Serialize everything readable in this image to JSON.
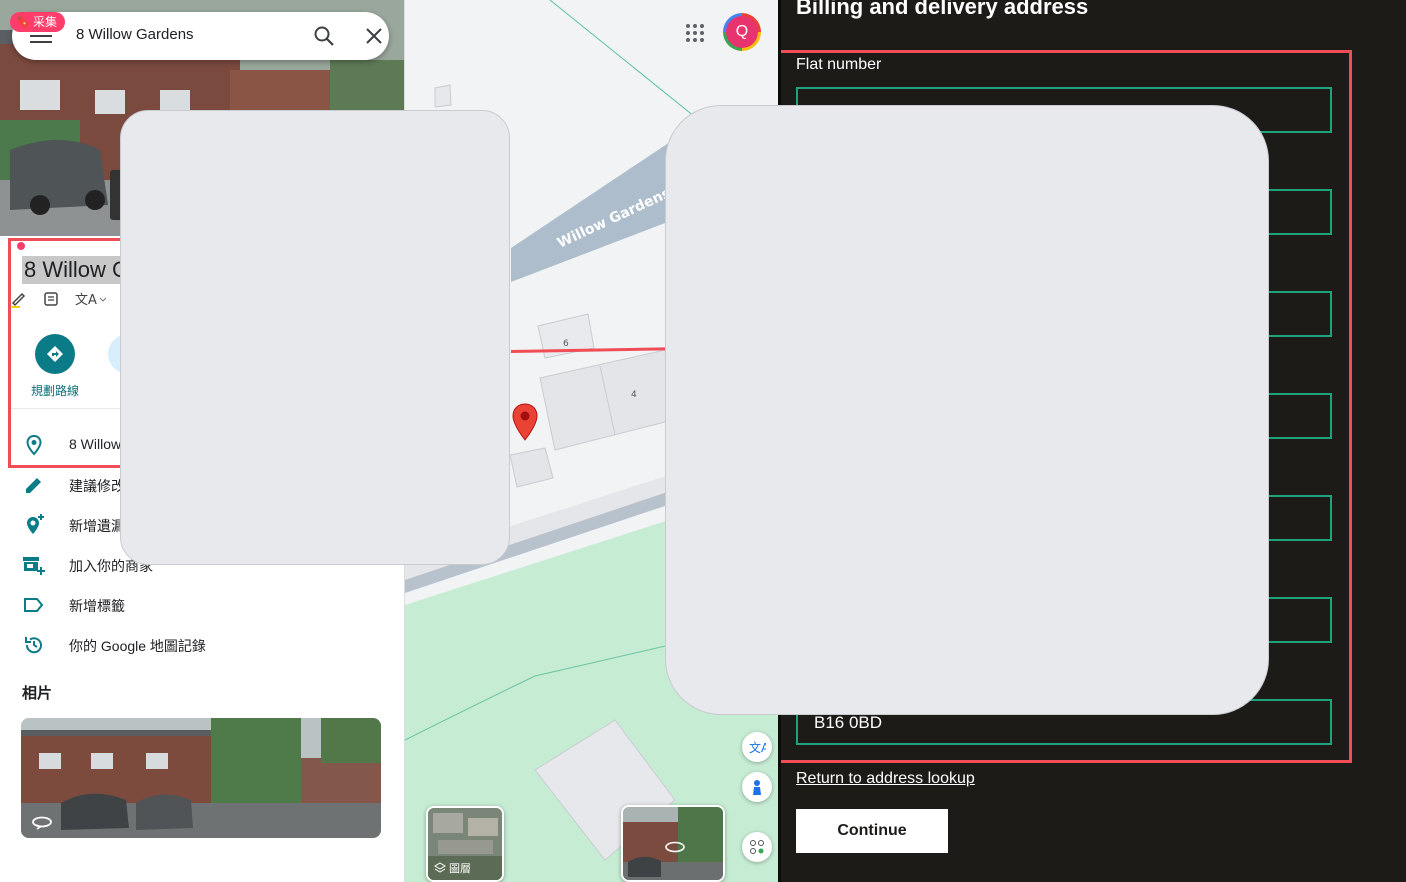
{
  "maps": {
    "search_query": "8 Willow Gardens",
    "collect_badge": "采集",
    "place_title": "8 Willow G",
    "directions_label": "規劃路線",
    "address_row": "8 Willow",
    "menu_items": [
      {
        "icon": "pencil-icon",
        "label": "建議修改"
      },
      {
        "icon": "add-location-icon",
        "label": "新增遺漏"
      },
      {
        "icon": "add-business-icon",
        "label": "加入你的商家"
      },
      {
        "icon": "label-icon",
        "label": "新增標籤"
      },
      {
        "icon": "history-icon",
        "label": "你的 Google 地圖記錄"
      }
    ],
    "photos_heading": "相片",
    "street_label": "Willow Gardens",
    "building_numbers": [
      "6",
      "4"
    ],
    "layers_label": "圖層",
    "avatar_letter": "Q"
  },
  "billing": {
    "title": "Billing and delivery address",
    "flat_label": "Flat number",
    "postcode_value": "B16 0BD",
    "return_link": "Return to address lookup",
    "continue_label": "Continue"
  },
  "colors": {
    "field_border": "#1fa37a",
    "highlight_red": "#f04d57",
    "panel_bg": "#1c1b18",
    "maps_teal": "#0b7c87"
  }
}
